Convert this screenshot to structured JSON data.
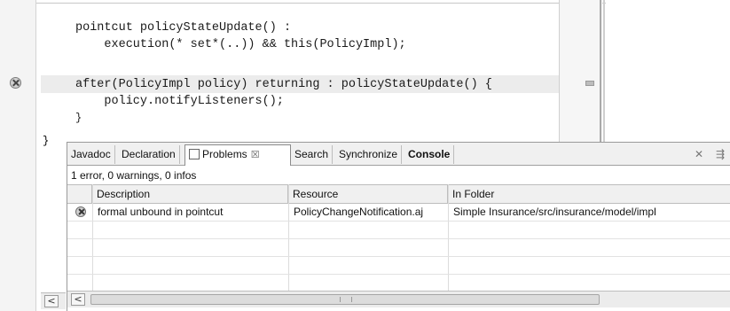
{
  "editor": {
    "code_lines": [
      "pointcut policyStateUpdate() :",
      "    execution(* set*(..)) && this(PolicyImpl);",
      "",
      "after(PolicyImpl policy) returning : policyStateUpdate() {",
      "    policy.notifyListeners();",
      "}"
    ],
    "closing_brace": "}"
  },
  "problems_view": {
    "tabs": [
      {
        "label": "Javadoc"
      },
      {
        "label": "Declaration"
      },
      {
        "label": "Problems",
        "active": true,
        "close_glyph": "☒"
      },
      {
        "label": "Search"
      },
      {
        "label": "Synchronize"
      },
      {
        "label": "Console",
        "bold": true
      }
    ],
    "toolbar_icons": [
      "close-all-icon",
      "pin-icon"
    ],
    "summary": "1 error, 0 warnings, 0 infos",
    "columns": [
      "Description",
      "Resource",
      "In Folder"
    ],
    "rows": [
      {
        "severity": "error",
        "description": "formal unbound in pointcut",
        "resource": "PolicyChangeNotification.aj",
        "folder": "Simple Insurance/src/insurance/model/impl"
      }
    ]
  }
}
